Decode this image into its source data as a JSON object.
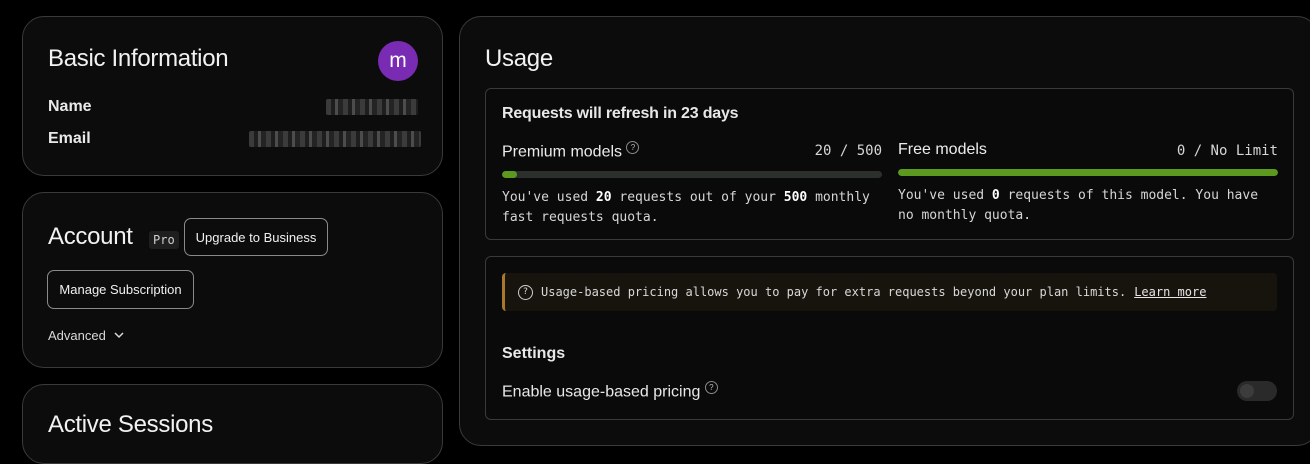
{
  "basic_info": {
    "title": "Basic Information",
    "avatar_letter": "m",
    "avatar_color": "#7a2bb3",
    "name_label": "Name",
    "email_label": "Email"
  },
  "account": {
    "title": "Account",
    "plan_badge": "Pro",
    "upgrade_button": "Upgrade to Business",
    "manage_button": "Manage Subscription",
    "advanced_label": "Advanced"
  },
  "sessions": {
    "title": "Active Sessions"
  },
  "usage": {
    "title": "Usage",
    "refresh_text": "Requests will refresh in 23 days",
    "premium": {
      "title": "Premium models",
      "count": "20 / 500",
      "used": 20,
      "limit": 500,
      "fill_fraction": 0.04,
      "desc_pre": "You've used ",
      "desc_used": "20",
      "desc_mid": " requests out of your ",
      "desc_limit": "500",
      "desc_post": " monthly fast requests quota."
    },
    "free": {
      "title": "Free models",
      "count": "0 / No Limit",
      "fill_fraction": 1.0,
      "desc_pre": "You've used ",
      "desc_used": "0",
      "desc_post": " requests of this model. You have no monthly quota."
    },
    "bar_color": "#5c9a1f",
    "notice": {
      "text": "Usage-based pricing allows you to pay for extra requests beyond your plan limits.",
      "link": "Learn more"
    },
    "settings": {
      "title": "Settings",
      "enable_label": "Enable usage-based pricing",
      "enabled": false
    }
  }
}
